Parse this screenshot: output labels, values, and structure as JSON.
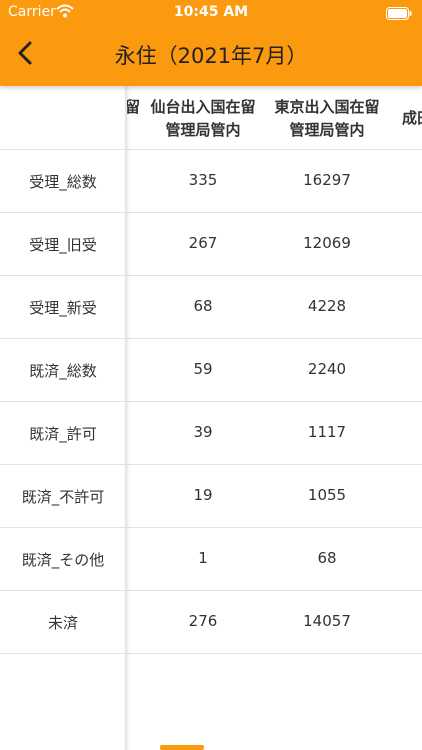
{
  "status_bar": {
    "carrier": "Carrier",
    "time": "10:45 AM"
  },
  "header": {
    "title": "永住（2021年7月）"
  },
  "columns": {
    "partial_left": "留",
    "sendai": "仙台出入国在留\n管理局管内",
    "tokyo": "東京出入国在留\n管理局管内",
    "partial_right": "成田"
  },
  "rows": [
    {
      "label": "受理_総数",
      "sendai": "335",
      "tokyo": "16297"
    },
    {
      "label": "受理_旧受",
      "sendai": "267",
      "tokyo": "12069"
    },
    {
      "label": "受理_新受",
      "sendai": "68",
      "tokyo": "4228"
    },
    {
      "label": "既済_総数",
      "sendai": "59",
      "tokyo": "2240"
    },
    {
      "label": "既済_許可",
      "sendai": "39",
      "tokyo": "1117"
    },
    {
      "label": "既済_不許可",
      "sendai": "19",
      "tokyo": "1055"
    },
    {
      "label": "既済_その他",
      "sendai": "1",
      "tokyo": "68"
    },
    {
      "label": "未済",
      "sendai": "276",
      "tokyo": "14057"
    }
  ]
}
